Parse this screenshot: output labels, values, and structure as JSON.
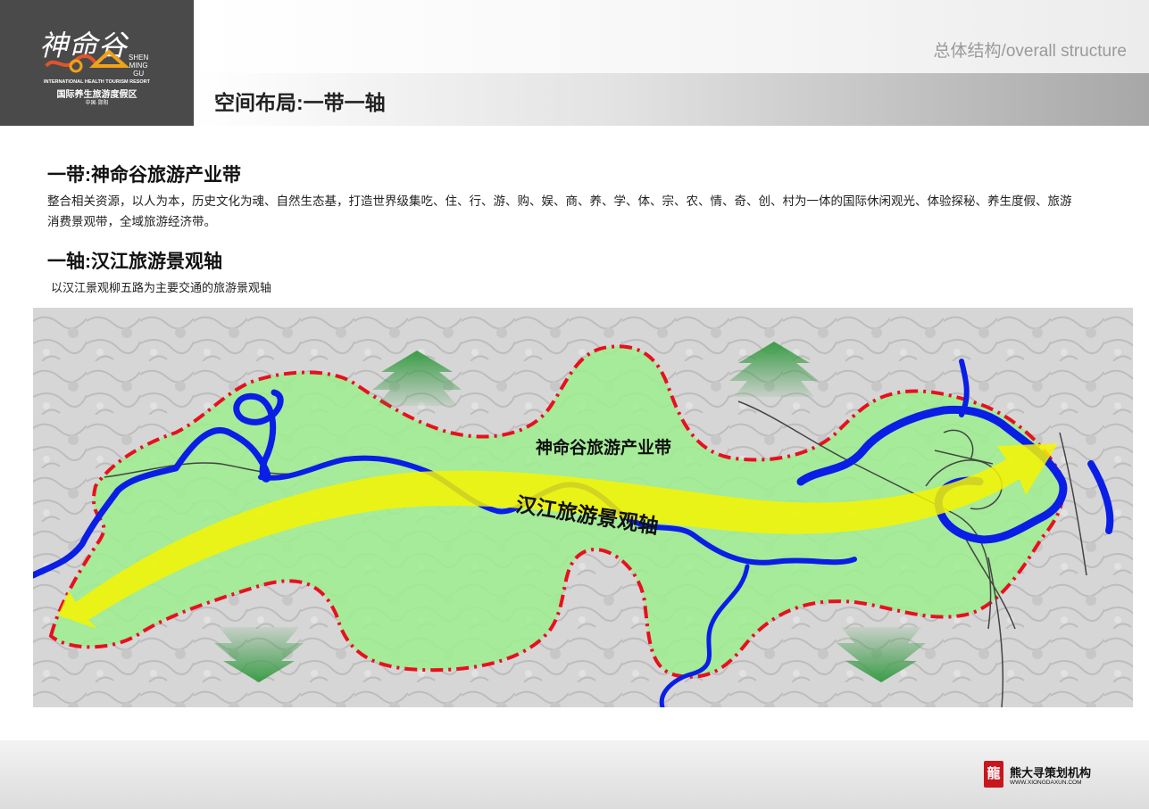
{
  "logo": {
    "script_title": "神命谷",
    "en_word_lines": [
      "SHEN",
      "MING",
      "GU"
    ],
    "en_full": "INTERNATIONAL HEALTH TOURISM RESORT",
    "cn_full": "国际养生旅游度假区",
    "location": "中国·郧阳"
  },
  "header": {
    "top_right_title": "总体结构/overall structure",
    "section_title": "空间布局:一带一轴"
  },
  "content": {
    "belt_heading": "一带:神命谷旅游产业带",
    "belt_text": "整合相关资源，以人为本，历史文化为魂、自然生态基，打造世界级集吃、住、行、游、购、娱、商、养、学、体、宗、农、情、奇、创、村为一体的国际休闲观光、体验探秘、养生度假、旅游消费景观带，全域旅游经济带。",
    "axis_heading": "一轴:汉江旅游景观轴",
    "axis_text": "以汉江景观柳五路为主要交通的旅游景观轴"
  },
  "map": {
    "belt_label": "神命谷旅游产业带",
    "axis_label": "汉江旅游景观轴",
    "colors": {
      "belt_fill": "#9cef8e",
      "belt_border": "#e8101e",
      "river": "#0a1ee6",
      "axis_arrow": "#f6f500",
      "expand_arrows": "#3a9c46"
    }
  },
  "footer": {
    "brand_mark": "龍",
    "brand_name": "熊大寻策划机构",
    "brand_url": "WWW.XIONGDAXUN.COM"
  }
}
